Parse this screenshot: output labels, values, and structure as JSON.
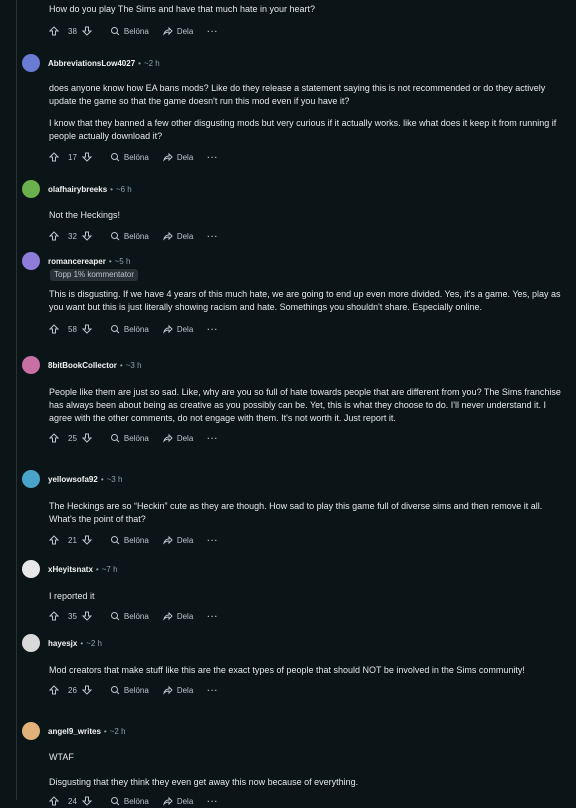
{
  "labels": {
    "reward": "Belöna",
    "share": "Dela",
    "more": "···",
    "dot": "•"
  },
  "top": {
    "text": "How do you play The Sims and have that much hate in your heart?",
    "score": "38"
  },
  "comments": [
    {
      "user": "AbbreviationsLow4027",
      "time": "~2 h",
      "avatar_color": "#6a7bd4",
      "paragraphs": [
        "does anyone know how EA bans mods? Like do they release a statement saying this is not recommended or do they actively update the game so that the game doesn't run this mod even if you have it?",
        "I know that they banned a few other disgusting mods but very curious if it actually works. like what does it keep it from running if people actually download it?"
      ],
      "score": "17"
    },
    {
      "user": "olafhairybreeks",
      "time": "~6 h",
      "avatar_color": "#6ab04c",
      "paragraphs": [
        "Not the Heckings!"
      ],
      "score": "32"
    },
    {
      "user": "romancereaper",
      "time": "~5 h",
      "avatar_color": "#8f7bd9",
      "flair": "Topp 1% kommentator",
      "paragraphs": [
        "This is disgusting. If we have 4 years of this much hate, we are going to end up even more divided. Yes, it's a game. Yes, play as you want but this is just literally showing racism and hate. Somethings you shouldn't share. Especially online."
      ],
      "score": "58"
    },
    {
      "user": "8bitBookCollector",
      "time": "~3 h",
      "avatar_color": "#c86fa4",
      "paragraphs": [
        "People like them are just so sad. Like, why are you so full of hate towards people that are different from you? The Sims franchise has always been about being as creative as you possibly can be. Yet, this is what they choose to do. I'll never understand it. I agree with the other comments, do not engage with them. It's not worth it. Just report it."
      ],
      "score": "25"
    },
    {
      "user": "yellowsofa92",
      "time": "~3 h",
      "avatar_color": "#4aa3c8",
      "paragraphs": [
        "The Heckings are so “Heckin” cute as they are though. How sad to play this game full of diverse sims and then remove it all. What's the point of that?"
      ],
      "score": "21"
    },
    {
      "user": "xHeyitsnatx",
      "time": "~7 h",
      "avatar_color": "#e8e8e8",
      "paragraphs": [
        "I reported it"
      ],
      "score": "35"
    },
    {
      "user": "hayesjx",
      "time": "~2 h",
      "avatar_color": "#d9d9d9",
      "paragraphs": [
        "Mod creators that make stuff like this are the exact types of people that should NOT be involved in the Sims community!"
      ],
      "score": "26"
    },
    {
      "user": "angel9_writes",
      "time": "~2 h",
      "avatar_color": "#e0b27a",
      "paragraphs": [
        "WTAF",
        "Disgusting that they think they even get away this now because of everything."
      ],
      "score": "24"
    }
  ]
}
